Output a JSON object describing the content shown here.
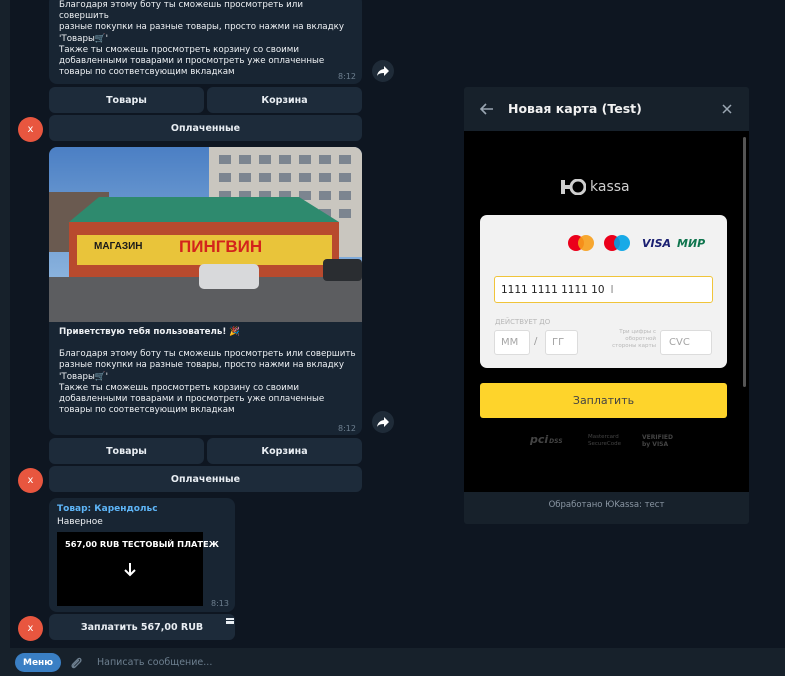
{
  "messages": [
    {
      "lines": [
        "Благодаря этому боту ты сможешь просмотреть или совершить",
        "разные покупки на разные товары, просто нажми на вкладку",
        "'Товары🛒'",
        "Также ты сможешь просмотреть корзину со своими",
        "добавленными товарами и просмотреть уже оплаченные",
        "товары по соответсвующим вкладкам"
      ],
      "time": "8:12"
    },
    {
      "greeting": "Приветствую тебя пользователь! 🎉",
      "lines": [
        "Благодаря этому боту ты сможешь просмотреть или совершить",
        "разные покупки на разные товары, просто нажми на вкладку",
        "'Товары🛒'",
        "Также ты сможешь просмотреть корзину со своими",
        "добавленными товарами и просмотреть уже оплаченные",
        "товары по соответсвующим вкладкам"
      ],
      "time": "8:12"
    }
  ],
  "keyboard": {
    "goods": "Товары",
    "cart": "Корзина",
    "paid": "Оплаченные"
  },
  "avatar_letter": "x",
  "photo_sign": {
    "left": "МАГАЗИН",
    "right": "ПИНГВИН"
  },
  "invoice": {
    "title": "Товар: Карендольс",
    "description": "Наверное",
    "thumb_text": "567,00 RUB ТЕСТОВЫЙ ПЛАТЕЖ",
    "time": "8:13",
    "pay_button": "Заплатить 567,00 RUB"
  },
  "composer": {
    "menu": "Меню",
    "placeholder": "Написать сообщение..."
  },
  "payment_panel": {
    "title": "Новая карта (Test)",
    "brand_logo": "kassa",
    "card_brands": [
      "VISA",
      "МИР"
    ],
    "card_number": "1111 1111 1111 10",
    "valid_until_label": "ДЕЙСТВУЕТ ДО",
    "month_placeholder": "ММ",
    "year_placeholder": "ГГ",
    "separator": "/",
    "cvc_hint": "Три цифры с оборотной стороны карты",
    "cvc_placeholder": "CVC",
    "pay_button": "Заплатить",
    "badges": [
      "DSS",
      "Mastercard SecureCode",
      "VERIFIED by VISA"
    ],
    "footer": "Обработано ЮKassa: тест"
  },
  "colors": {
    "background": "#0e1621",
    "bubble": "#182533",
    "panel": "#17212b",
    "accent": "#5eb5f7",
    "pay": "#fed42b",
    "avatar": "#e8563f"
  }
}
